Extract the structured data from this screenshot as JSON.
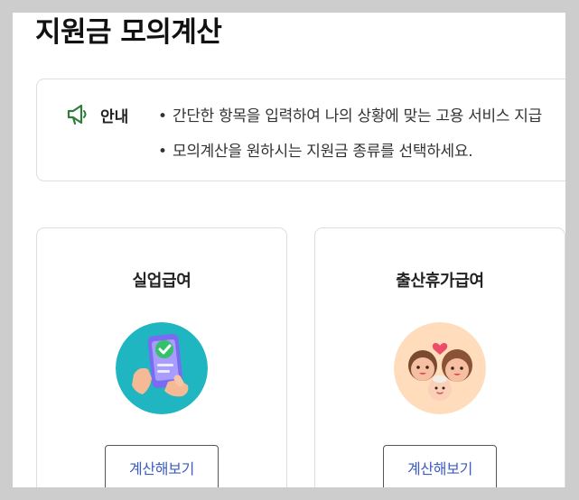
{
  "page": {
    "title": "지원금 모의계산"
  },
  "notice": {
    "label": "안내",
    "icon": "megaphone-icon",
    "accent": "#2f7d3a",
    "lines": [
      "간단한 항목을 입력하여 나의 상황에 맞는 고용 서비스 지급",
      "모의계산을 원하시는 지원금 종류를 선택하세요."
    ],
    "bullet": "•"
  },
  "cards": [
    {
      "title": "실업급여",
      "image": "phone-checklist-illustration",
      "image_bg": "#1fb6c1",
      "button_label": "계산해보기"
    },
    {
      "title": "출산휴가급여",
      "image": "family-illustration",
      "image_bg": "#ffdcbc",
      "button_label": "계산해보기"
    }
  ],
  "colors": {
    "button_text": "#3d5bc4",
    "border": "#dedede"
  }
}
